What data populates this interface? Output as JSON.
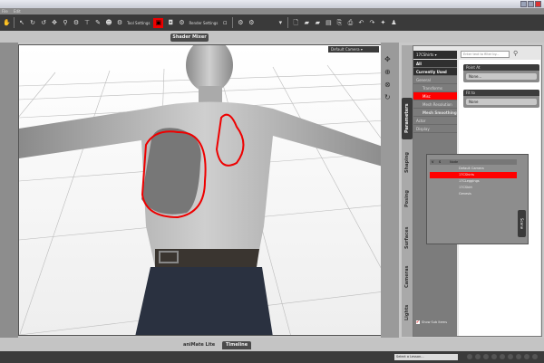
{
  "menu": [
    "File",
    "Edit"
  ],
  "toolbar": {
    "tool_settings": "Tool Settings",
    "render_settings": "Render Settings"
  },
  "shader_mixer": "Shader Mixer",
  "viewport": {
    "camera": "Default Camera",
    "annotation_color": "#e00000"
  },
  "side_tabs": [
    "Parameters",
    "Shaping",
    "Posing",
    "Surfaces",
    "Cameras",
    "Lights"
  ],
  "panel": {
    "node": "17CShirts",
    "filter_placeholder": "Enter text to filter by...",
    "categories": [
      "All",
      "Currently Used",
      "General",
      "Transforms",
      "Misc",
      "Mesh Resolution",
      "Mesh Smoothing",
      "Actor",
      "Display"
    ],
    "props": [
      {
        "label": "Point At",
        "value": "None..."
      },
      {
        "label": "Fit to",
        "value": "None"
      }
    ],
    "show_sub_items": "Show Sub Items"
  },
  "scene": {
    "tab": "Scene",
    "col_v": "V",
    "col_s": "S",
    "col_node": "Node",
    "rows": [
      "Default Camera",
      "17CShirts",
      "17CLeggings",
      "17CSkirt",
      "Genesis"
    ]
  },
  "bottom_tabs": [
    "aniMate Lite",
    "Timeline"
  ],
  "lesson": "Select a Lesson..."
}
